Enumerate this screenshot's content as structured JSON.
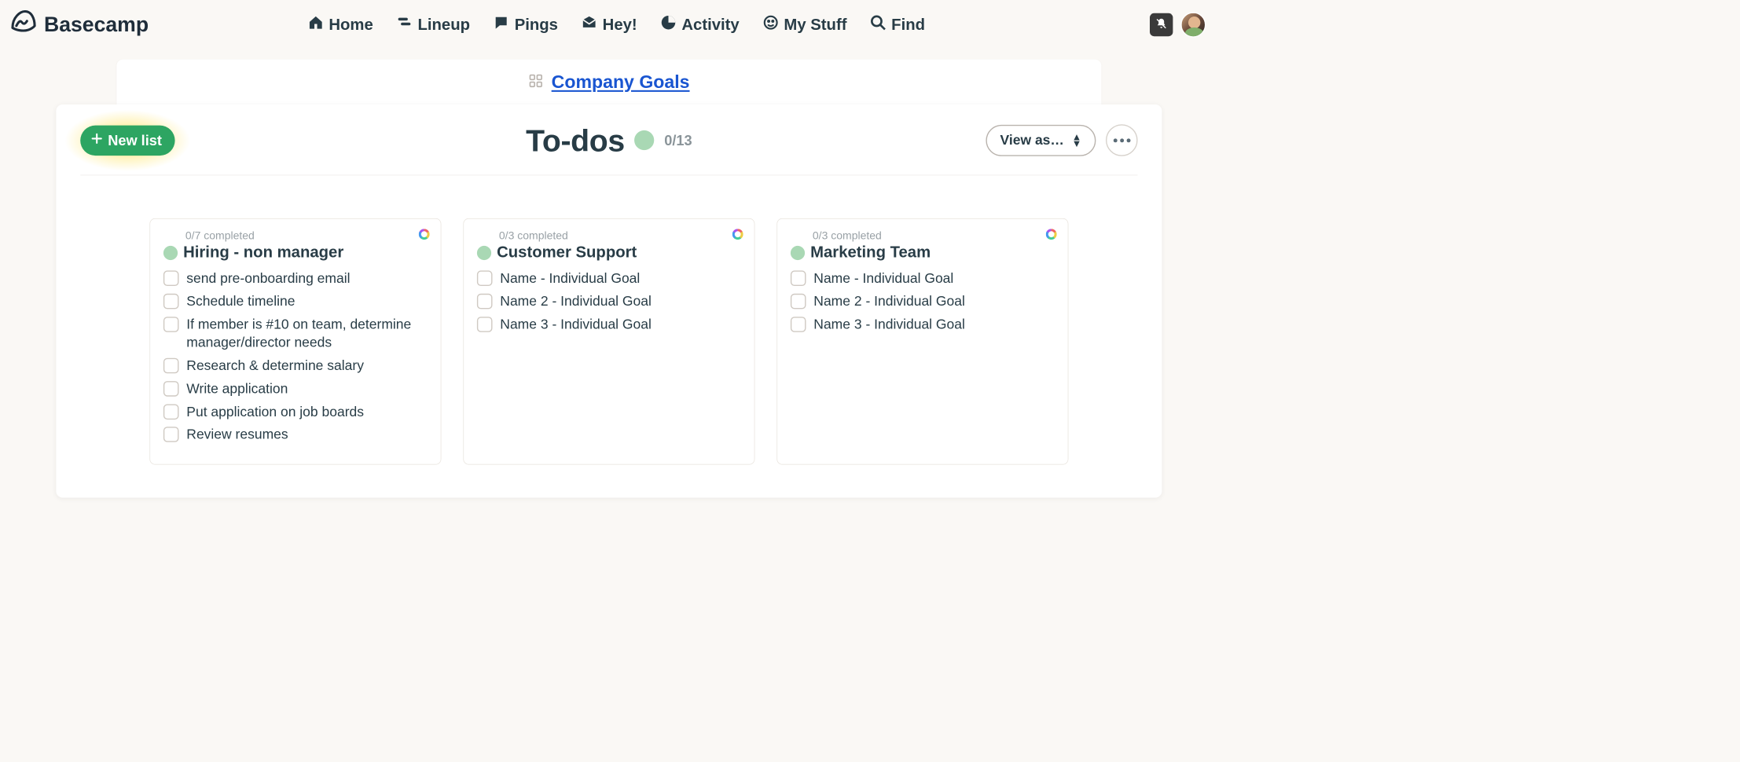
{
  "app_name": "Basecamp",
  "nav": {
    "home": "Home",
    "lineup": "Lineup",
    "pings": "Pings",
    "hey": "Hey!",
    "activity": "Activity",
    "mystuff": "My Stuff",
    "find": "Find"
  },
  "breadcrumb": {
    "project": "Company Goals"
  },
  "page": {
    "title": "To-dos",
    "count": "0/13",
    "new_list_label": "New list",
    "view_as_label": "View as…"
  },
  "lists": [
    {
      "completed": "0/7 completed",
      "title": "Hiring - non manager",
      "items": [
        "send pre-onboarding email",
        "Schedule timeline",
        "If member is #10 on team, determine manager/director needs",
        "Research & determine salary",
        "Write application",
        "Put application on job boards",
        "Review resumes"
      ]
    },
    {
      "completed": "0/3 completed",
      "title": "Customer Support",
      "items": [
        "Name - Individual Goal",
        "Name 2 - Individual Goal",
        "Name 3 - Individual Goal"
      ]
    },
    {
      "completed": "0/3 completed",
      "title": "Marketing Team",
      "items": [
        "Name - Individual Goal",
        "Name 2 - Individual Goal",
        "Name 3 - Individual Goal"
      ]
    }
  ]
}
